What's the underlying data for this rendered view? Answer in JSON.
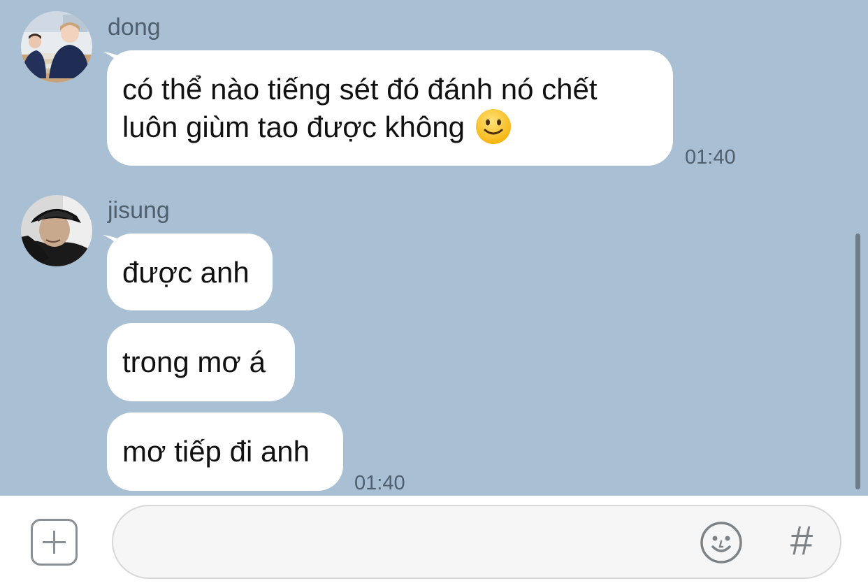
{
  "messages": [
    {
      "sender": "dong",
      "avatar": "photo-avatar-dong",
      "lines": [
        "có thể nào tiếng sét đó đánh nó chết",
        "luôn giùm tao được không"
      ],
      "emoji": "slightly-smiling-face-icon",
      "time": "01:40"
    },
    {
      "sender": "jisung",
      "avatar": "photo-avatar-jisung",
      "bubbles": [
        "được anh",
        "trong mơ á",
        "mơ tiếp đi anh"
      ],
      "time": "01:40"
    }
  ],
  "composer": {
    "input_value": "",
    "input_placeholder": "",
    "add_icon": "plus-square-icon",
    "emoji_icon": "smiley-face-icon",
    "hashtag_label": "#"
  },
  "colors": {
    "chat_background": "#a9bfd3",
    "bubble": "#ffffff",
    "meta_text": "#4f5f6e"
  }
}
